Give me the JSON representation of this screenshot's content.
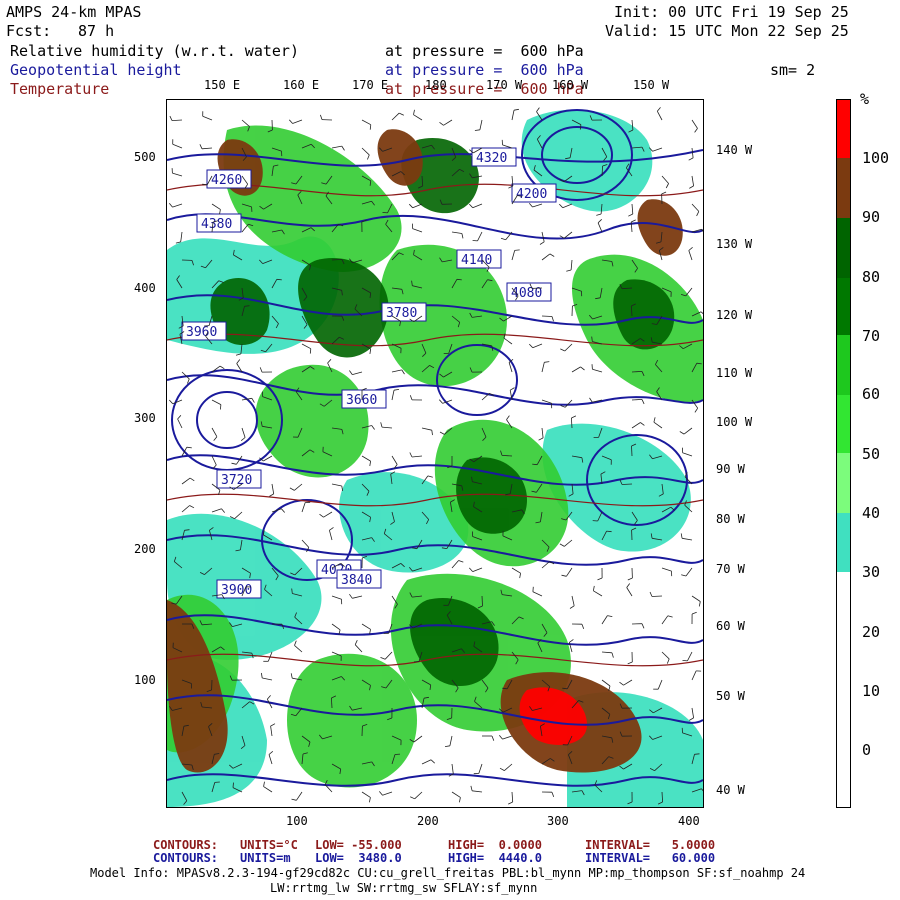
{
  "header": {
    "model": "AMPS 24-km MPAS",
    "fcst_label": "Fcst:",
    "fcst_value": "87 h",
    "init": "Init: 00 UTC Fri 19 Sep 25",
    "valid": "Valid: 15 UTC Mon 22 Sep 25",
    "fields": [
      {
        "name": "Relative humidity (w.r.t. water)",
        "level": "at pressure =  600 hPa",
        "color": "#000000"
      },
      {
        "name": "Geopotential height",
        "level": "at pressure =  600 hPa",
        "color": "#1a1a9c"
      },
      {
        "name": "Temperature",
        "level": "at pressure =  600 hPa",
        "color": "#8b1a1a"
      }
    ],
    "smoothing": "sm= 2"
  },
  "map": {
    "top_lon_labels": [
      "150 E",
      "160 E",
      "170 E",
      "180",
      "170 W",
      "160 W",
      "150 W"
    ],
    "right_lon_labels": [
      "140 W",
      "130 W",
      "120 W",
      "110 W",
      "100 W",
      "90 W",
      "80 W",
      "70 W",
      "60 W",
      "50 W",
      "40 W"
    ],
    "y_ticks": [
      "500",
      "400",
      "300",
      "200",
      "100"
    ],
    "x_ticks": [
      "100",
      "200",
      "300",
      "400"
    ],
    "height_labels": [
      "4320",
      "4260",
      "4200",
      "4380",
      "4140",
      "4080",
      "4020",
      "3960",
      "3900",
      "3840",
      "3780",
      "3720",
      "3660"
    ],
    "colors": {
      "rh_30": "#40e0c0",
      "rh_40": "#7cfc7c",
      "rh_50": "#32cd32",
      "rh_60": "#20b020",
      "rh_70": "#007800",
      "rh_80": "#006400",
      "rh_90": "#7b3a10",
      "rh_100": "#ff0000",
      "height_contour": "#1a1a9c",
      "temp_contour": "#8b1a1a"
    }
  },
  "colorbar": {
    "unit": "%",
    "labels": [
      "100",
      "90",
      "80",
      "70",
      "60",
      "50",
      "40",
      "30",
      "20",
      "10",
      "0"
    ],
    "segments": [
      {
        "color": "#ff0000"
      },
      {
        "color": "#7b3a10"
      },
      {
        "color": "#006400"
      },
      {
        "color": "#007800"
      },
      {
        "color": "#1ec81e"
      },
      {
        "color": "#32e632"
      },
      {
        "color": "#7cfc7c"
      },
      {
        "color": "#40e0c0"
      },
      {
        "color": "#ffffff"
      },
      {
        "color": "#ffffff"
      },
      {
        "color": "#ffffff"
      },
      {
        "color": "#ffffff"
      }
    ]
  },
  "footer": {
    "temp_contours": {
      "label": "CONTOURS:",
      "units": "UNITS=°C",
      "low": "LOW= -55.000",
      "high": "HIGH=  0.0000",
      "interval": "INTERVAL=   5.0000"
    },
    "height_contours": {
      "label": "CONTOURS:",
      "units": "UNITS=m",
      "low": "LOW=  3480.0",
      "high": "HIGH=  4440.0",
      "interval": "INTERVAL=   60.000"
    },
    "model_info": "Model Info: MPASv8.2.3-194-gf29cd82c CU:cu_grell_freitas PBL:bl_mynn MP:mp_thompson SF:sf_noahmp 24",
    "model_info_2": "LW:rrtmg_lw SW:rrtmg_sw SFLAY:sf_mynn"
  }
}
